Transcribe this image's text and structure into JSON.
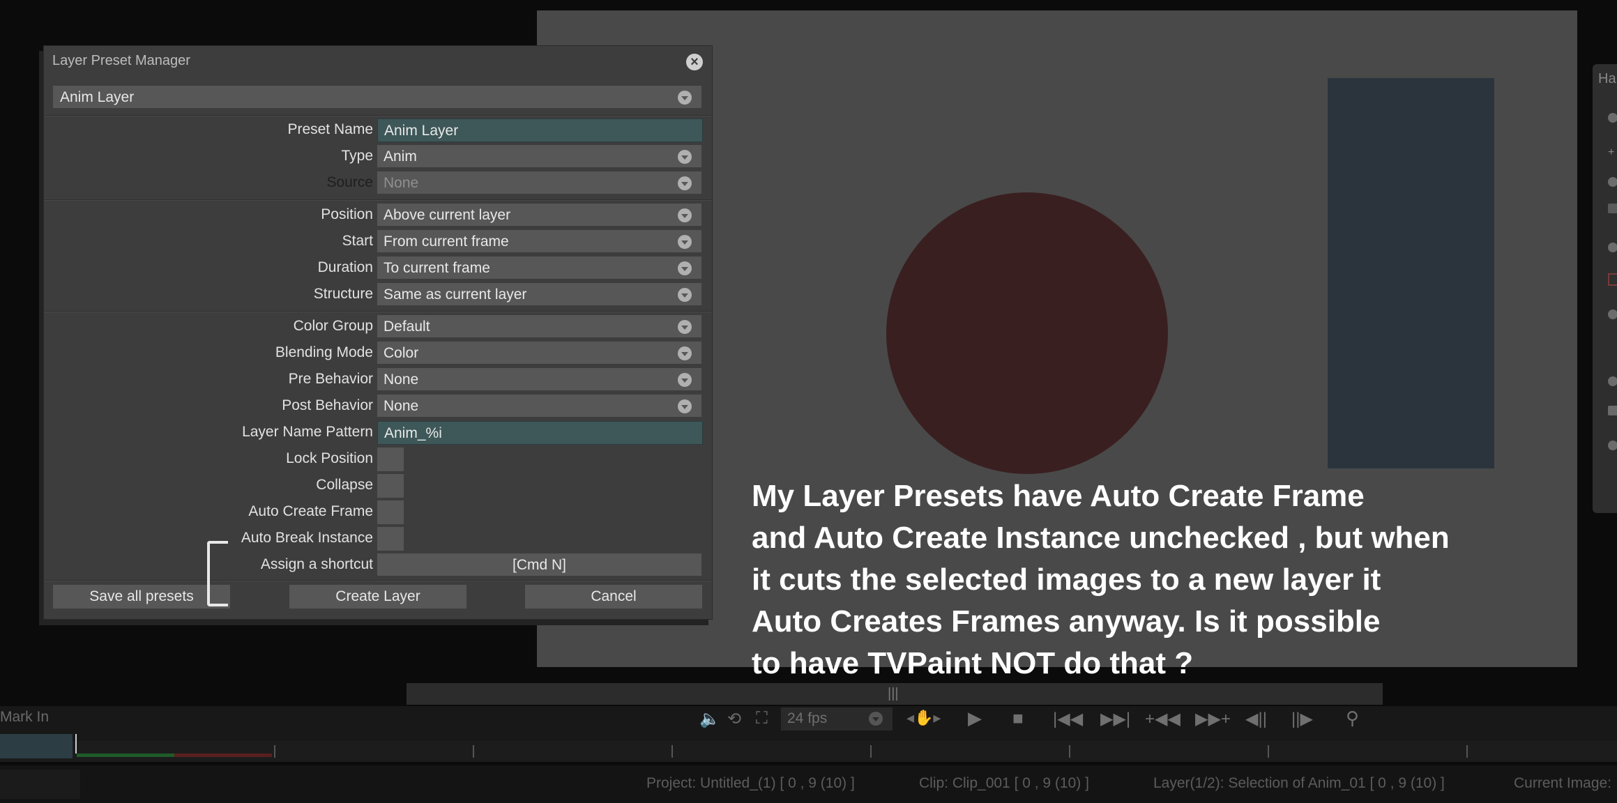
{
  "dialog": {
    "title": "Layer Preset Manager",
    "preset_selected": "Anim Layer",
    "fields": {
      "preset_name": {
        "label": "Preset Name",
        "value": "Anim Layer"
      },
      "type": {
        "label": "Type",
        "value": "Anim"
      },
      "source": {
        "label": "Source",
        "value": "None"
      },
      "position": {
        "label": "Position",
        "value": "Above current layer"
      },
      "start": {
        "label": "Start",
        "value": "From current frame"
      },
      "duration": {
        "label": "Duration",
        "value": "To current frame"
      },
      "structure": {
        "label": "Structure",
        "value": "Same as current layer"
      },
      "color_group": {
        "label": "Color Group",
        "value": "Default"
      },
      "blending_mode": {
        "label": "Blending Mode",
        "value": "Color"
      },
      "pre_behavior": {
        "label": "Pre Behavior",
        "value": "None"
      },
      "post_behavior": {
        "label": "Post Behavior",
        "value": "None"
      },
      "layer_name_pattern": {
        "label": "Layer Name Pattern",
        "value": "Anim_%i"
      },
      "lock_position": {
        "label": "Lock Position",
        "checked": false
      },
      "collapse": {
        "label": "Collapse",
        "checked": false
      },
      "auto_create_frame": {
        "label": "Auto Create Frame",
        "checked": false
      },
      "auto_break_instance": {
        "label": "Auto Break Instance",
        "checked": false
      },
      "assign_shortcut": {
        "label": "Assign a shortcut",
        "value": "[Cmd N]"
      }
    },
    "buttons": {
      "save_all": "Save all presets",
      "create_layer": "Create Layer",
      "cancel": "Cancel"
    }
  },
  "annotation": {
    "lines": [
      "My Layer Presets have Auto Create Frame",
      "and Auto Create Instance unchecked , but when",
      "it cuts the selected images to a new layer it",
      "Auto Creates Frames anyway.  Is it possible",
      "to have TVPaint NOT do that ?"
    ]
  },
  "right_panel": {
    "partial_label": "Ha"
  },
  "timeline": {
    "mark_in": "Mark In",
    "fps": "24 fps",
    "grip": "|||"
  },
  "status_bar": {
    "project": "Project: Untitled_(1) [ 0 , 9  (10) ]",
    "clip": "Clip: Clip_001 [ 0 , 9  (10) ]",
    "layer": "Layer(1/2): Selection of Anim_01 [ 0 , 9  (10) ]",
    "current_image": "Current Image:"
  },
  "colors": {
    "canvas_bg": "#494949",
    "circle_fill": "#3a1f20",
    "rect_fill": "#2b343d",
    "dialog_bg": "#3d3d3d",
    "text_field_bg": "#3e5758"
  }
}
